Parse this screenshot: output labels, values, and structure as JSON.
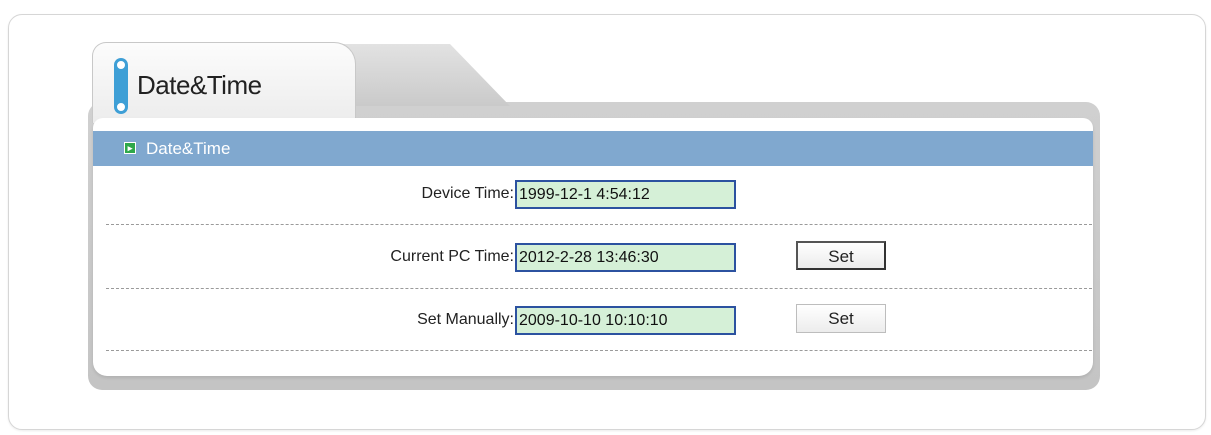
{
  "tab": {
    "title": "Date&Time"
  },
  "section": {
    "title": "Date&Time"
  },
  "rows": [
    {
      "label": "Device Time:",
      "value": "1999-12-1 4:54:12"
    },
    {
      "label": "Current PC Time:",
      "value": "2012-2-28 13:46:30",
      "button": "Set"
    },
    {
      "label": "Set Manually:",
      "value": "2009-10-10 10:10:10",
      "button": "Set"
    }
  ],
  "colors": {
    "header_bar": "#80a8cf",
    "field_bg": "#d5f0d7",
    "field_border": "#2c52a0",
    "tab_marker": "#3e9fd6"
  },
  "icons": {
    "section_icon": "play-arrow-icon",
    "tab_marker": "tab-marker-icon"
  }
}
